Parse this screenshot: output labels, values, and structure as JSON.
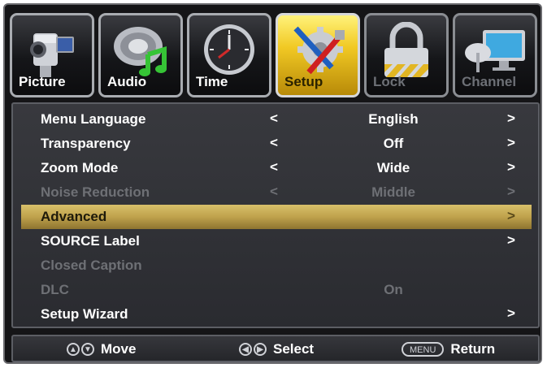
{
  "tabs": [
    {
      "label": "Picture",
      "icon": "camcorder-icon",
      "state": "normal"
    },
    {
      "label": "Audio",
      "icon": "speaker-music-icon",
      "state": "normal"
    },
    {
      "label": "Time",
      "icon": "clock-icon",
      "state": "normal"
    },
    {
      "label": "Setup",
      "icon": "tools-gear-icon",
      "state": "active"
    },
    {
      "label": "Lock",
      "icon": "padlock-icon",
      "state": "dim"
    },
    {
      "label": "Channel",
      "icon": "satellite-monitor-icon",
      "state": "dim"
    }
  ],
  "menu": {
    "items": [
      {
        "label": "Menu Language",
        "value": "English",
        "state": "normal",
        "left_arrow": "<",
        "right_arrow": ">"
      },
      {
        "label": "Transparency",
        "value": "Off",
        "state": "normal",
        "left_arrow": "<",
        "right_arrow": ">"
      },
      {
        "label": "Zoom Mode",
        "value": "Wide",
        "state": "normal",
        "left_arrow": "<",
        "right_arrow": ">"
      },
      {
        "label": "Noise Reduction",
        "value": "Middle",
        "state": "disabled",
        "left_arrow": "<",
        "right_arrow": ">"
      },
      {
        "label": "Advanced",
        "value": "",
        "state": "selected",
        "left_arrow": "",
        "right_arrow": ">"
      },
      {
        "label": "SOURCE Label",
        "value": "",
        "state": "normal",
        "left_arrow": "",
        "right_arrow": ">"
      },
      {
        "label": "Closed Caption",
        "value": "",
        "state": "disabled",
        "left_arrow": "",
        "right_arrow": ""
      },
      {
        "label": "DLC",
        "value": "On",
        "state": "disabled",
        "left_arrow": "",
        "right_arrow": ""
      },
      {
        "label": "Setup Wizard",
        "value": "",
        "state": "normal",
        "left_arrow": "",
        "right_arrow": ">"
      }
    ]
  },
  "footer": {
    "move_label": "Move",
    "select_label": "Select",
    "menu_key": "MENU",
    "return_label": "Return"
  },
  "colors": {
    "active_tab": "#f1c924",
    "selected_row": "#bfa24c",
    "disabled_text": "#6e7075"
  }
}
